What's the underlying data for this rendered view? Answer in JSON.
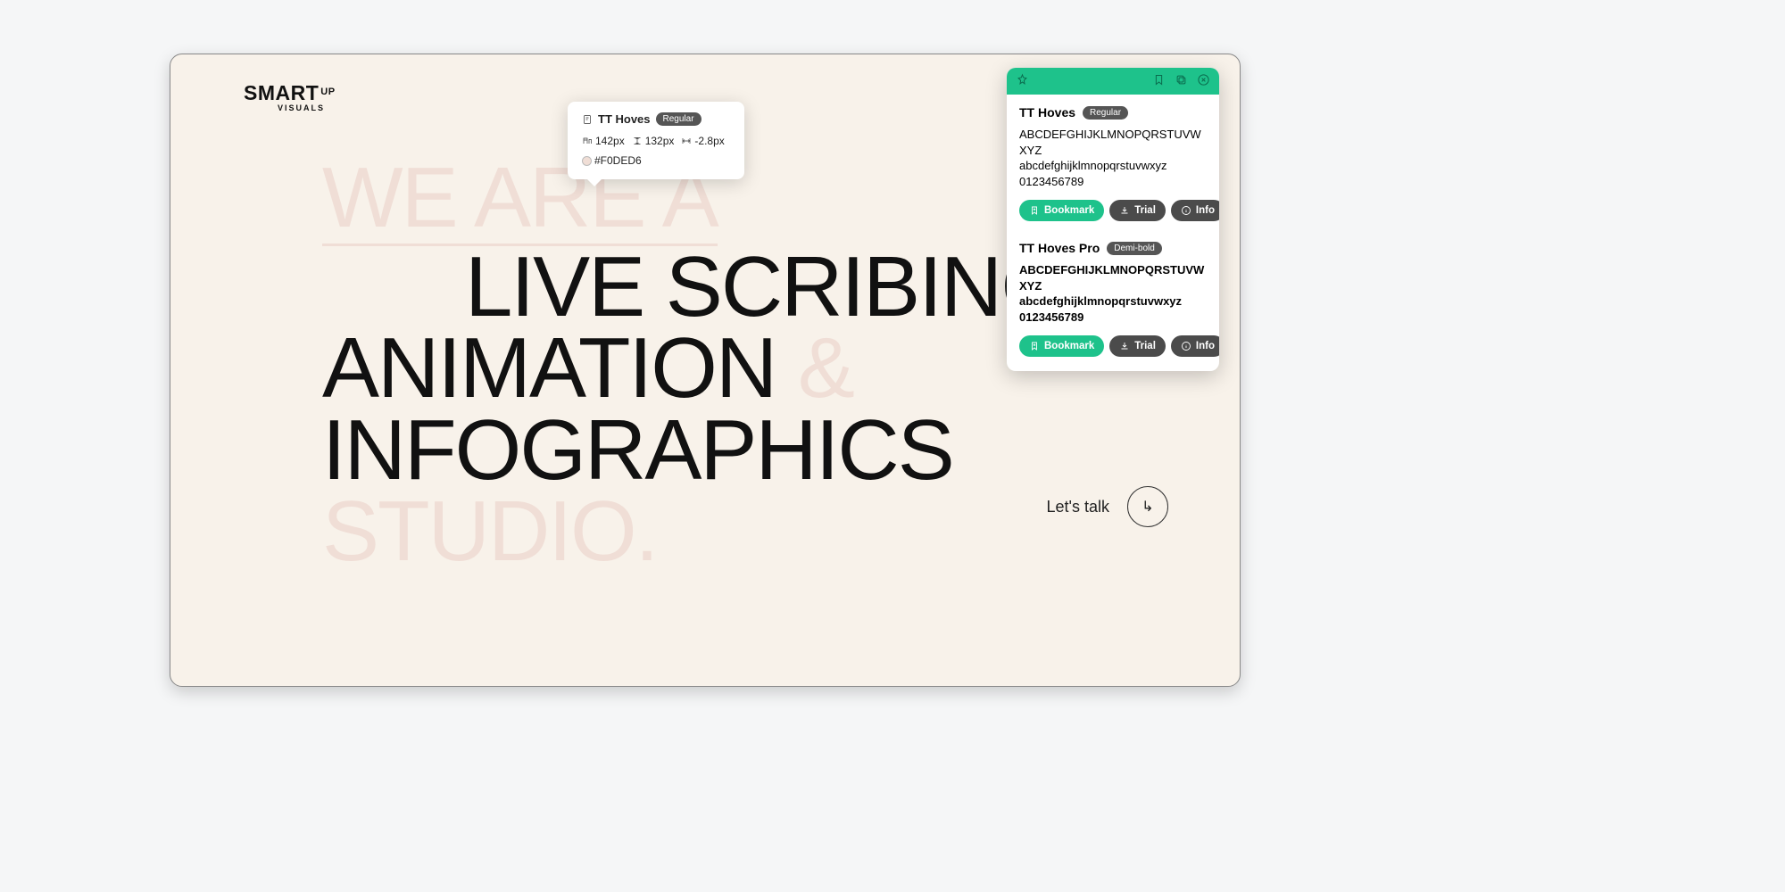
{
  "logo": {
    "brand": "SMART",
    "sup": "UP",
    "sub": "VISUALS"
  },
  "hero": {
    "line1": "WE ARE A",
    "line2": "LIVE SCRIBING",
    "line3_a": "ANIMATION",
    "line3_amp": "&",
    "line4": "INFOGRAPHICS",
    "line5": "STUDIO."
  },
  "cta": {
    "label": "Let's talk"
  },
  "tooltip": {
    "font_name": "TT Hoves",
    "weight_badge": "Regular",
    "font_size": "142px",
    "line_height": "132px",
    "letter_spacing": "-2.8px",
    "color_hex": "#F0DED6"
  },
  "panel": {
    "fonts": [
      {
        "name": "TT Hoves",
        "weight_badge": "Regular",
        "sample_upper": "ABCDEFGHIJKLMNOPQRSTUVWXYZ",
        "sample_lower": "abcdefghijklmnopqrstuvwxyz",
        "sample_digits": "0123456789",
        "bold": false
      },
      {
        "name": "TT Hoves Pro",
        "weight_badge": "Demi-bold",
        "sample_upper": "ABCDEFGHIJKLMNOPQRSTUVWXYZ",
        "sample_lower": "abcdefghijklmnopqrstuvwxyz",
        "sample_digits": "0123456789",
        "bold": true
      }
    ],
    "buttons": {
      "bookmark": "Bookmark",
      "trial": "Trial",
      "info": "Info"
    }
  }
}
